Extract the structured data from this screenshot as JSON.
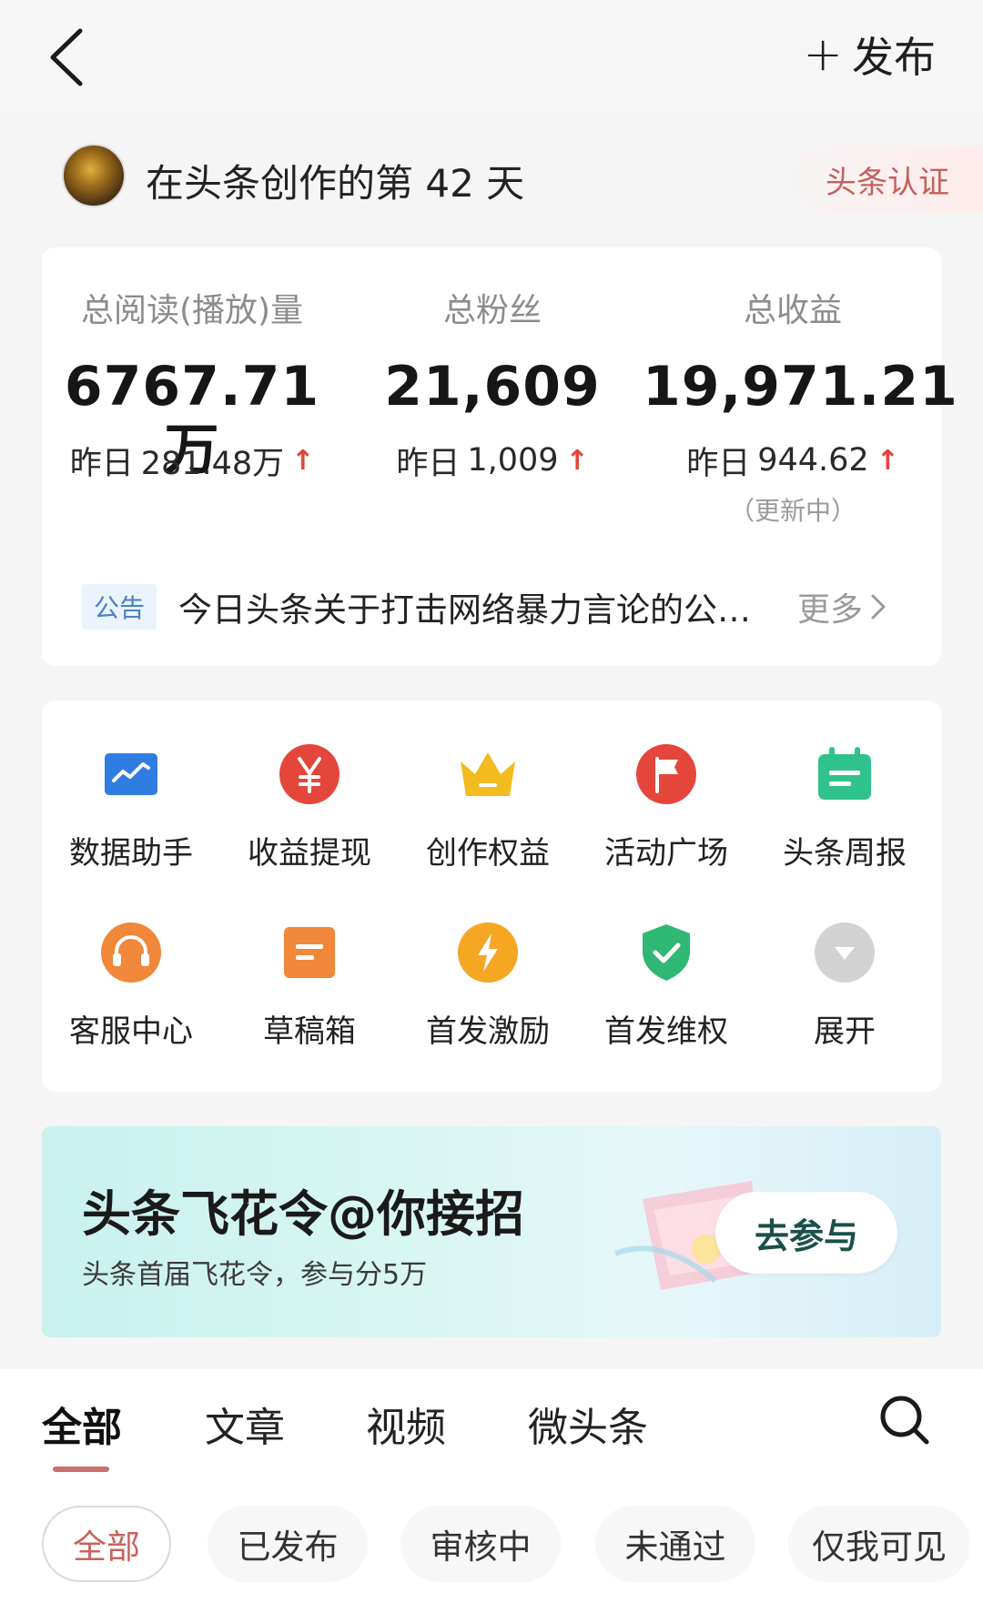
{
  "header": {
    "publish_plus": "+",
    "publish_label": "发布"
  },
  "profile": {
    "days_text": "在头条创作的第 42 天",
    "cert_label": "头条认证"
  },
  "stats": [
    {
      "label": "总阅读(播放)量",
      "value": "6767.71万",
      "delta_prefix": "昨日",
      "delta": "281.48万",
      "note": ""
    },
    {
      "label": "总粉丝",
      "value": "21,609",
      "delta_prefix": "昨日",
      "delta": "1,009",
      "note": ""
    },
    {
      "label": "总收益",
      "value": "19,971.21",
      "delta_prefix": "昨日",
      "delta": "944.62",
      "note": "（更新中）"
    }
  ],
  "notice": {
    "tag": "公告",
    "text": "今日头条关于打击网络暴力言论的公…",
    "more": "更多"
  },
  "tools": [
    {
      "label": "数据助手",
      "icon": "chart-icon",
      "color": "#2f7de1"
    },
    {
      "label": "收益提现",
      "icon": "yuan-icon",
      "color": "#e5463b"
    },
    {
      "label": "创作权益",
      "icon": "crown-icon",
      "color": "#f2bb1e"
    },
    {
      "label": "活动广场",
      "icon": "flag-icon",
      "color": "#e5463b"
    },
    {
      "label": "头条周报",
      "icon": "calendar-icon",
      "color": "#2fc28c"
    },
    {
      "label": "客服中心",
      "icon": "headset-icon",
      "color": "#f0873a"
    },
    {
      "label": "草稿箱",
      "icon": "draft-icon",
      "color": "#f0873a"
    },
    {
      "label": "首发激励",
      "icon": "lightning-icon",
      "color": "#f5a623"
    },
    {
      "label": "首发维权",
      "icon": "shield-icon",
      "color": "#2fb873"
    },
    {
      "label": "展开",
      "icon": "expand-icon",
      "color": "#c8c8c8"
    }
  ],
  "banner": {
    "title": "头条飞花令@你接招",
    "subtitle": "头条首届飞花令，参与分5万",
    "button": "去参与"
  },
  "content_tabs": [
    "全部",
    "文章",
    "视频",
    "微头条"
  ],
  "filters": [
    "全部",
    "已发布",
    "审核中",
    "未通过",
    "仅我可见"
  ],
  "colors": {
    "accent_red": "#e4453a",
    "active_tab_underline": "#c96f6c"
  }
}
